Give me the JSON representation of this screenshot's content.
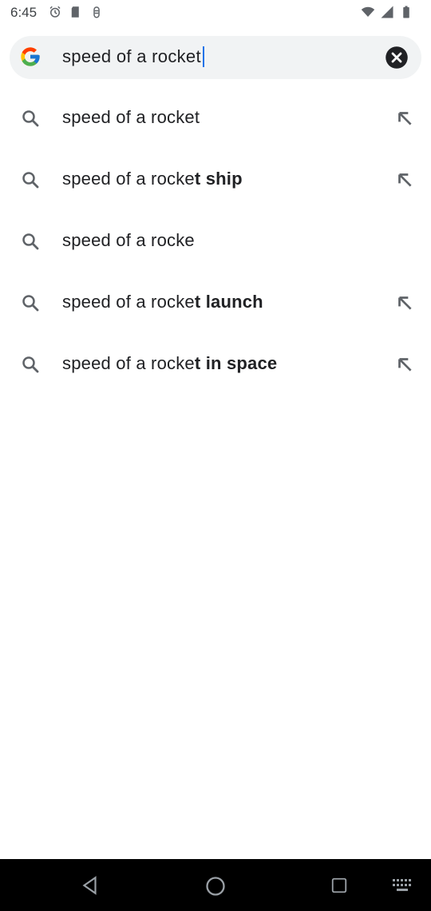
{
  "status_bar": {
    "time": "6:45",
    "icons_left": [
      "alarm-icon",
      "sd-card-icon",
      "cloud-sync-icon"
    ],
    "icons_right": [
      "wifi-icon",
      "cellular-icon",
      "battery-icon"
    ]
  },
  "search": {
    "query": "speed of a rocket"
  },
  "suggestions": [
    {
      "prefix": "speed of a rocket",
      "completion": "",
      "has_arrow": true
    },
    {
      "prefix": "speed of a rocke",
      "completion": "t ship",
      "has_arrow": true
    },
    {
      "prefix": "speed of a rocke",
      "completion": "",
      "has_arrow": false
    },
    {
      "prefix": "speed of a rocke",
      "completion": "t launch",
      "has_arrow": true
    },
    {
      "prefix": "speed of a rocke",
      "completion": "t in space",
      "has_arrow": true
    }
  ],
  "nav_bar": {
    "buttons": [
      "back-icon",
      "home-icon",
      "recents-icon",
      "keyboard-icon"
    ]
  },
  "colors": {
    "search_bg": "#f1f3f4",
    "caret": "#1a73e8",
    "nav_bg": "#000000",
    "icon_gray": "#5f6368"
  }
}
